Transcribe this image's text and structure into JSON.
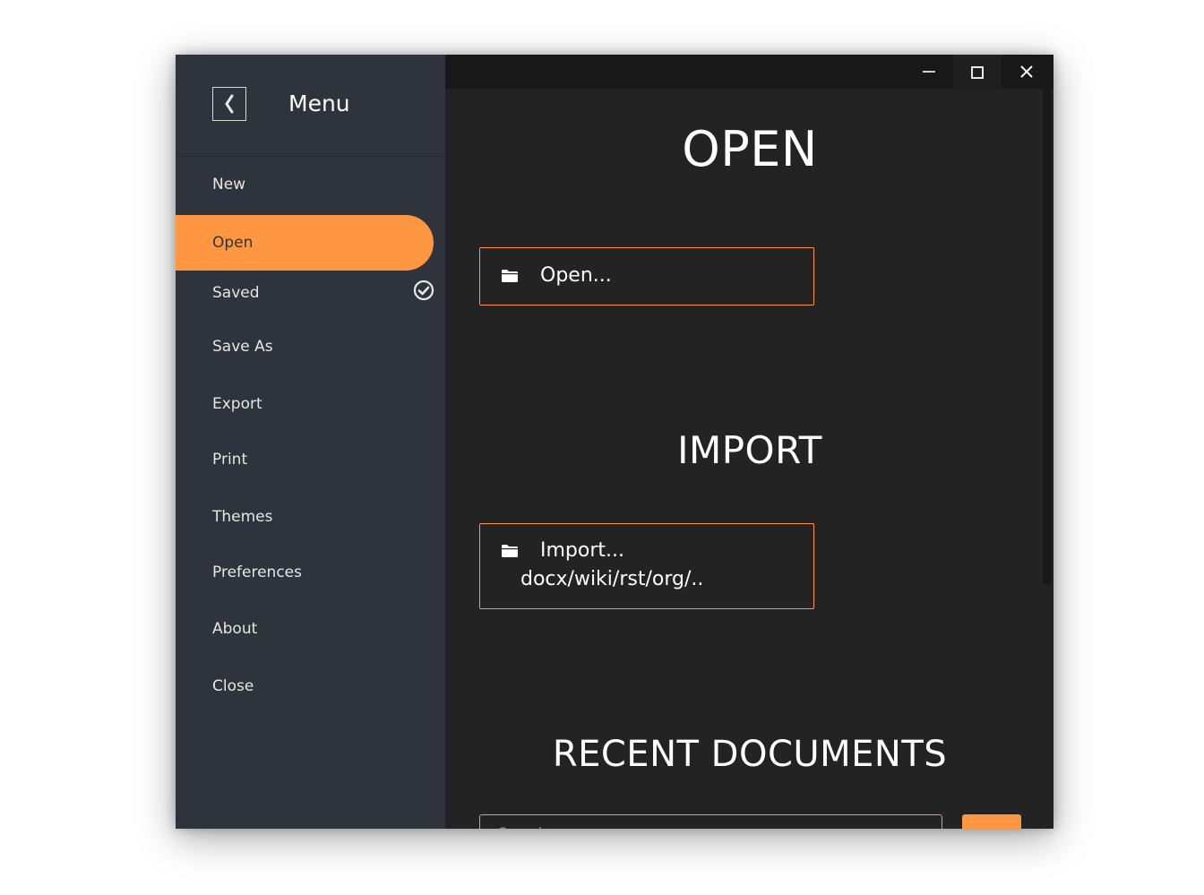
{
  "sidebar": {
    "title": "Menu",
    "items": [
      {
        "label": "New"
      },
      {
        "label": "Open"
      },
      {
        "label": "Saved"
      },
      {
        "label": "Save As"
      },
      {
        "label": "Export"
      },
      {
        "label": "Print"
      },
      {
        "label": "Themes"
      },
      {
        "label": "Preferences"
      },
      {
        "label": "About"
      },
      {
        "label": "Close"
      }
    ],
    "active_item": "Open",
    "saved_icon": "check-circle-icon"
  },
  "main": {
    "open_section": {
      "title": "OPEN",
      "button_label": "Open..."
    },
    "import_section": {
      "title": "IMPORT",
      "button_label": "Import...",
      "button_sublabel": "docx/wiki/rst/org/.."
    },
    "recent_section": {
      "title": "RECENT DOCUMENTS",
      "search_placeholder": "Search..."
    }
  },
  "icons": {
    "back": "chevron-left-icon",
    "folder": "folder-icon",
    "minimize": "minimize-icon",
    "maximize": "maximize-icon",
    "close": "close-icon"
  },
  "colors": {
    "accent": "#ff9742",
    "sidebar_bg": "#2f333b",
    "content_bg": "#232323",
    "titlebar_bg": "#181818"
  }
}
